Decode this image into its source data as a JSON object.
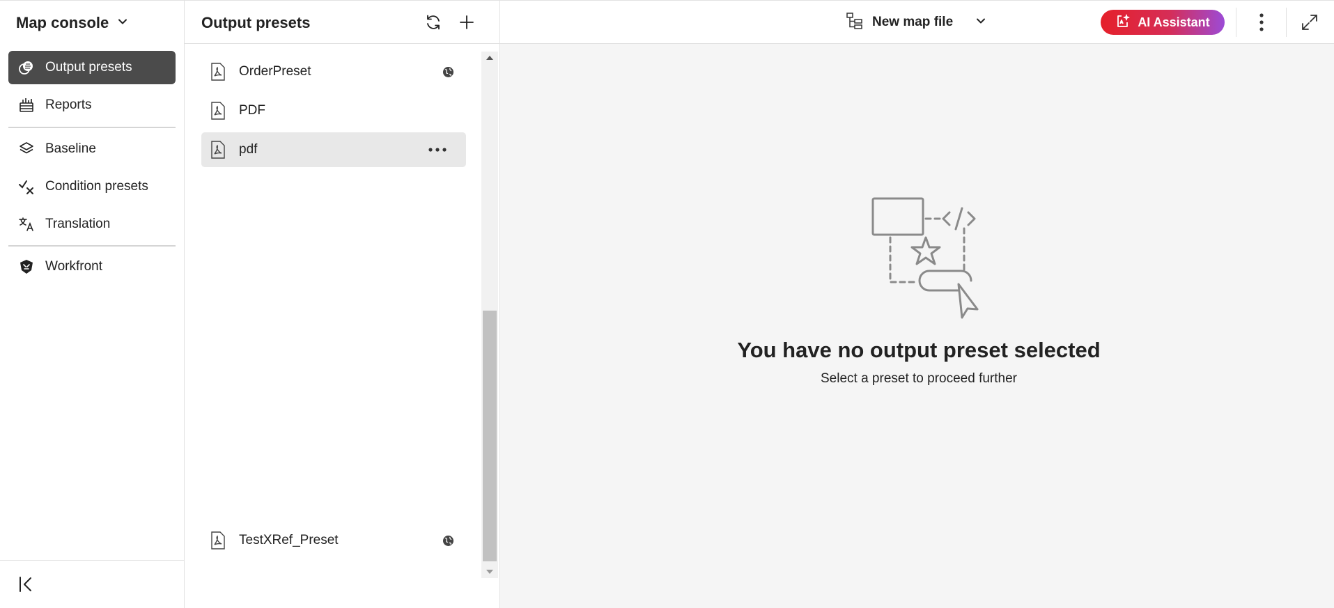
{
  "nav": {
    "header_title": "Map console",
    "items": [
      {
        "label": "Output presets",
        "icon": "output-presets-icon",
        "active": true
      },
      {
        "label": "Reports",
        "icon": "reports-icon"
      },
      {
        "label": "Baseline",
        "icon": "layers-icon"
      },
      {
        "label": "Condition presets",
        "icon": "condition-icon"
      },
      {
        "label": "Translation",
        "icon": "translate-icon"
      },
      {
        "label": "Workfront",
        "icon": "workfront-icon"
      }
    ],
    "collapse_icon": "collapse-left-icon"
  },
  "presets": {
    "title": "Output presets",
    "refresh_icon": "refresh-icon",
    "add_icon": "plus-icon",
    "items": [
      {
        "label": "OrderPreset",
        "global": true
      },
      {
        "label": "PDF",
        "global": false
      },
      {
        "label": "pdf",
        "global": false,
        "selected": true
      },
      {
        "label": "TestXRef_Preset",
        "global": true
      }
    ]
  },
  "topbar": {
    "map_file": "New map file",
    "ai_button": "AI Assistant",
    "ai_colors": [
      "#e5202a",
      "#9c4bd6"
    ]
  },
  "empty_state": {
    "title": "You have no output preset selected",
    "subtitle": "Select a preset to proceed further"
  }
}
